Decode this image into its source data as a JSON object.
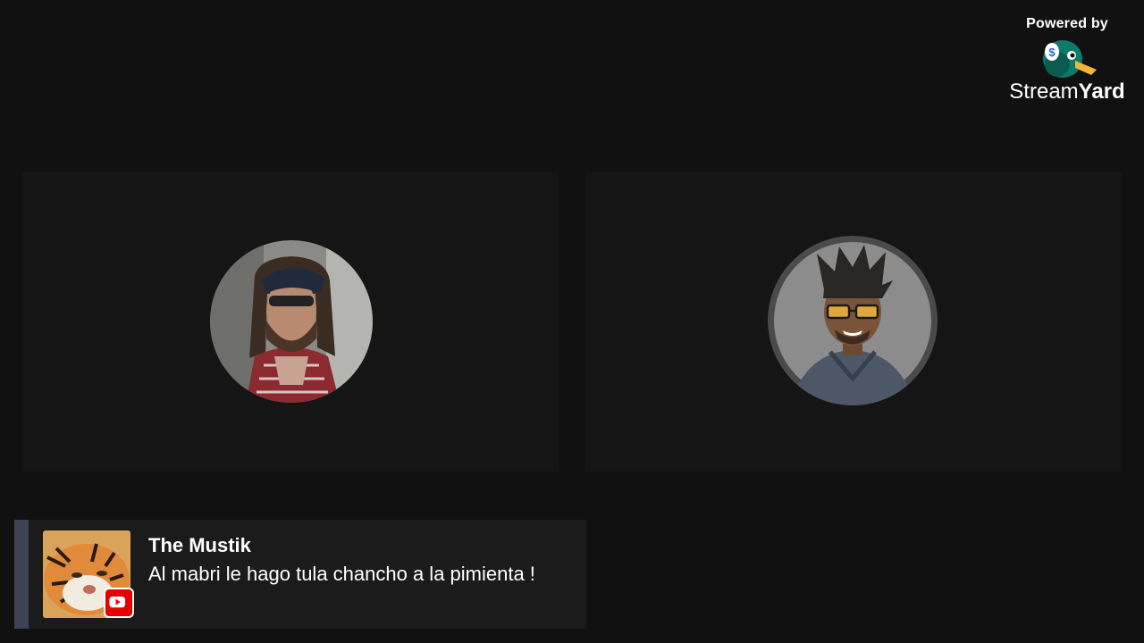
{
  "branding": {
    "powered_by": "Powered by",
    "wordmark_part1": "Stream",
    "wordmark_part2": "Yard",
    "logo_icon": "streamyard-duck-icon"
  },
  "participants": [
    {
      "avatar": "participant-photo-avatar"
    },
    {
      "avatar": "participant-cartoon-avatar"
    }
  ],
  "comment": {
    "name": "The Mustik",
    "text": "Al mabri le hago tula chancho a la pimienta !",
    "platform_icon": "youtube-icon"
  },
  "colors": {
    "background": "#111111",
    "tile": "#151515",
    "banner": "#1b1b1b",
    "accent": "#3d4352",
    "youtube": "#e60000"
  }
}
